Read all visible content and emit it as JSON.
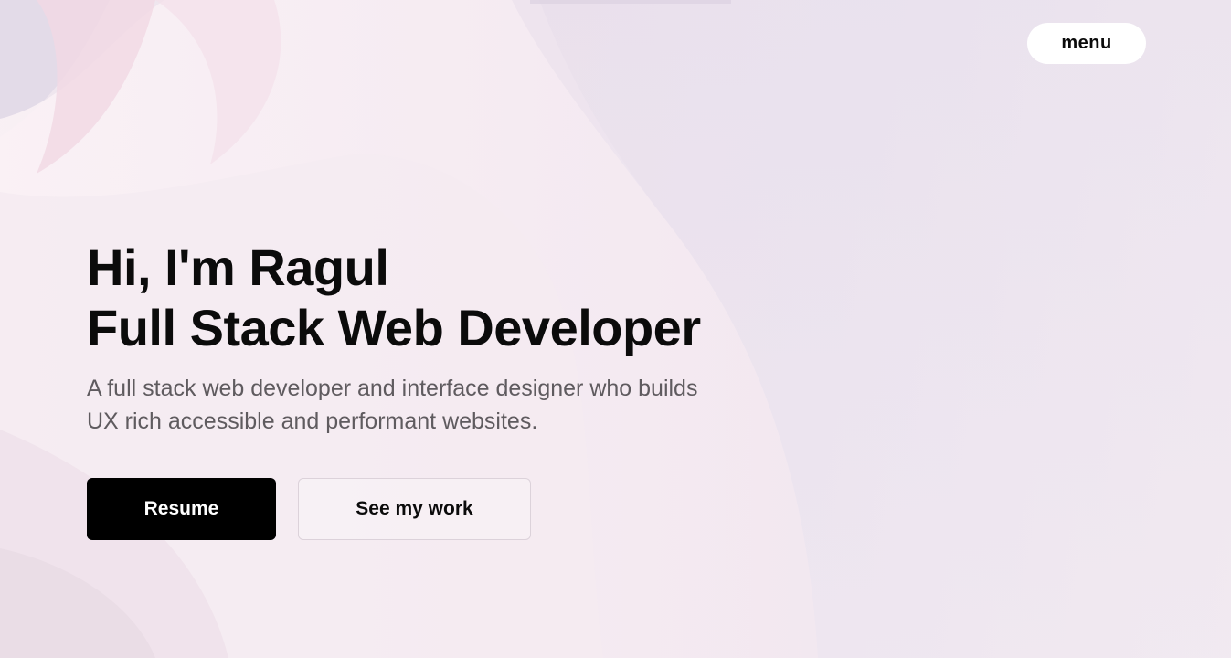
{
  "nav": {
    "menu_label": "menu"
  },
  "hero": {
    "headline_line1": "Hi, I'm Ragul",
    "headline_line2": "Full Stack Web Developer",
    "subtitle_line1": "A full stack web developer and interface designer who builds",
    "subtitle_line2": "UX rich accessible and performant websites."
  },
  "actions": {
    "resume_label": "Resume",
    "work_label": "See my work"
  },
  "colors": {
    "background": "#f1e8f0",
    "text": "#0b0b0b",
    "subtitle": "#5f5b5f",
    "primary_button": "#000000",
    "menu_button": "#ffffff"
  }
}
